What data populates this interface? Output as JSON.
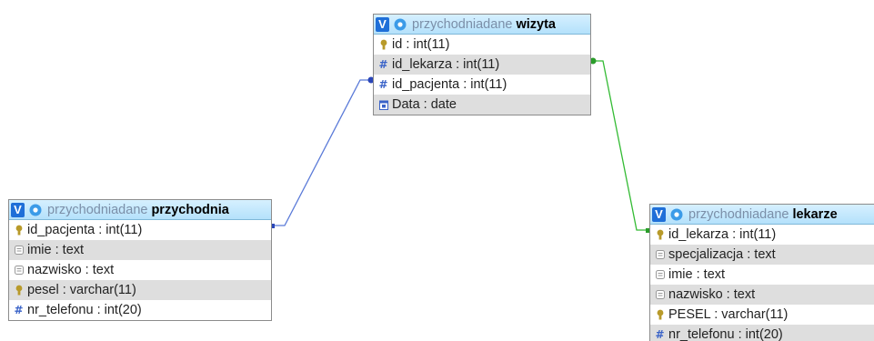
{
  "tables": {
    "wizyta": {
      "db": "przychodniadane",
      "name": "wizyta",
      "columns": [
        {
          "text": "id : int(11)",
          "icon": "primary-key-icon"
        },
        {
          "text": "id_lekarza : int(11)",
          "icon": "numeric-icon"
        },
        {
          "text": "id_pacjenta : int(11)",
          "icon": "numeric-icon"
        },
        {
          "text": "Data : date",
          "icon": "date-icon"
        }
      ]
    },
    "przychodnia": {
      "db": "przychodniadane",
      "name": "przychodnia",
      "columns": [
        {
          "text": "id_pacjenta : int(11)",
          "icon": "primary-key-icon"
        },
        {
          "text": "imie : text",
          "icon": "text-icon"
        },
        {
          "text": "nazwisko : text",
          "icon": "text-icon"
        },
        {
          "text": "pesel : varchar(11)",
          "icon": "primary-key-icon"
        },
        {
          "text": "nr_telefonu : int(20)",
          "icon": "numeric-icon"
        }
      ]
    },
    "lekarze": {
      "db": "przychodniadane",
      "name": "lekarze",
      "columns": [
        {
          "text": "id_lekarza : int(11)",
          "icon": "primary-key-icon"
        },
        {
          "text": "specjalizacja : text",
          "icon": "text-icon"
        },
        {
          "text": "imie : text",
          "icon": "text-icon"
        },
        {
          "text": "nazwisko : text",
          "icon": "text-icon"
        },
        {
          "text": "PESEL : varchar(11)",
          "icon": "primary-key-icon"
        },
        {
          "text": "nr_telefonu : int(20)",
          "icon": "numeric-icon"
        }
      ]
    }
  },
  "toggle_label": "V",
  "colors": {
    "link_przychodnia_wizyta": "#5a7ad8",
    "link_wizyta_lekarze": "#33bb33",
    "header_bg": "#c4e8fd",
    "db_name": "#7b8fa8"
  }
}
